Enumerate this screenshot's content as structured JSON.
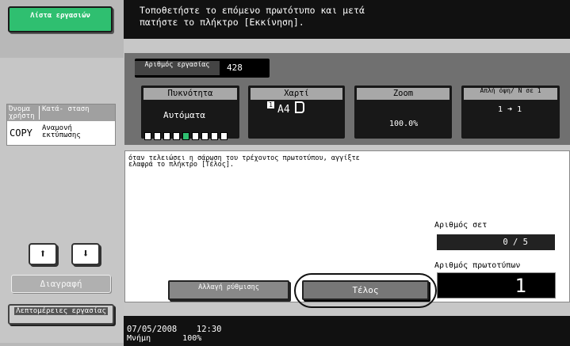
{
  "sidebar": {
    "jobs_button": "Λίστα εργασιών",
    "job_table": {
      "col_user": "Όνομα χρήστη",
      "col_status": "Κατά- σταση",
      "row_user": "COPY",
      "row_status": "Αναμονή εκτύπωσης"
    },
    "up_arrow": "⬆",
    "down_arrow": "⬇",
    "delete_label": "Διαγραφή",
    "details_label": "Λεπτομέρειες εργασίας"
  },
  "message": {
    "line1": "Τοποθετήστε το επόμενο πρωτότυπο και μετά",
    "line2": "πατήστε το πλήκτρο [Εκκίνηση]."
  },
  "job_number": {
    "label": "Αριθμός εργασίας",
    "value": "428"
  },
  "tiles": {
    "density": {
      "label": "Πυκνότητα",
      "value": "Αυτόματα",
      "level_fraction": 0.5
    },
    "paper": {
      "label": "Χαρτί",
      "value": "A4"
    },
    "zoom": {
      "label": "Zoom",
      "value": "100.0%"
    },
    "duplex": {
      "label": "Απλή όψη/ Ν σε 1",
      "value": "1 ➜ 1"
    }
  },
  "info": {
    "text": "όταν τελειώσει η σάρωση του τρέχοντος πρωτοτύπου, αγγίξτε ελαφρά το πλήκτρο [Τέλος].",
    "sets_label": "Αριθμός σετ",
    "sets_value": "0 / 5",
    "originals_label": "Αριθμός πρωτοτύπων",
    "originals_value": "1"
  },
  "buttons": {
    "change_settings": "Αλλαγή ρύθμισης",
    "finish": "Τέλος"
  },
  "footer": {
    "date": "07/05/2008",
    "time": "12:30",
    "memory_label": "Μνήμη",
    "memory_value": "100%"
  },
  "colors": {
    "jobs_button": "#2fbf70",
    "panel": "#707070",
    "bar": "#111111"
  }
}
